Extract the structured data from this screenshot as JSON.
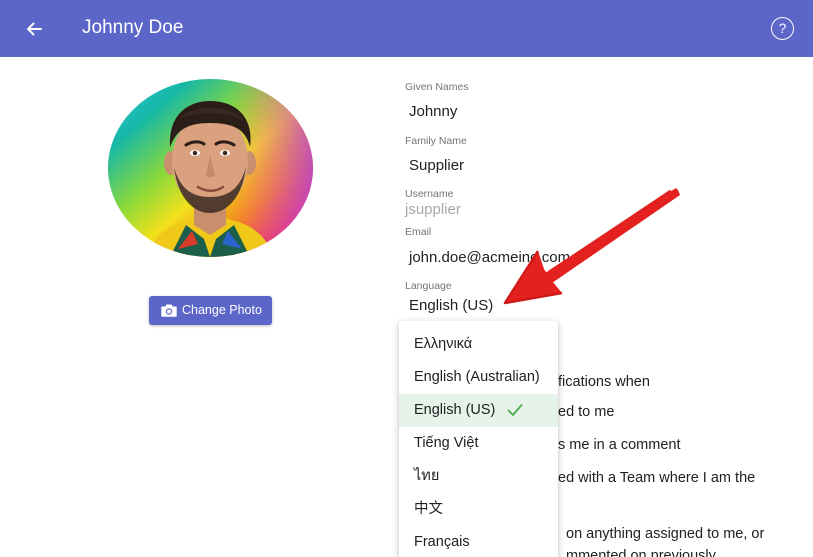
{
  "appbar": {
    "title": "Johnny Doe",
    "back_icon": "arrow-left-icon",
    "help_icon": "help-circle-icon",
    "help_glyph": "?",
    "color": "#5b66c8"
  },
  "profile": {
    "change_photo_label": "Change Photo",
    "camera_icon": "camera-icon"
  },
  "fields": {
    "given_names": {
      "label": "Given Names",
      "value": "Johnny"
    },
    "family_name": {
      "label": "Family Name",
      "value": "Supplier"
    },
    "username": {
      "label": "Username",
      "value": "jsupplier"
    },
    "email": {
      "label": "Email",
      "value": "john.doe@acmeinc.com"
    },
    "language": {
      "label": "Language",
      "value": "English (US)"
    }
  },
  "notifications": {
    "line1": "fications when",
    "line2": "ed to me",
    "line3": "s me in a comment",
    "line4": "ed with a Team where I am the",
    "line5": "on anything assigned to me, or",
    "line6": "mmented on previously"
  },
  "language_menu": {
    "items": [
      {
        "label": "Ελληνικά",
        "selected": false
      },
      {
        "label": "English (Australian)",
        "selected": false
      },
      {
        "label": "English (US)",
        "selected": true
      },
      {
        "label": "Tiếng Việt",
        "selected": false
      },
      {
        "label": "ไทย",
        "selected": false
      },
      {
        "label": "中文",
        "selected": false
      },
      {
        "label": "Français",
        "selected": false
      }
    ],
    "check_icon": "check-icon",
    "selected_bg": "#e6f3ea",
    "check_color": "#4caf50"
  },
  "annotation": {
    "arrow_color": "#e3211f",
    "icon": "red-arrow-annotation"
  }
}
